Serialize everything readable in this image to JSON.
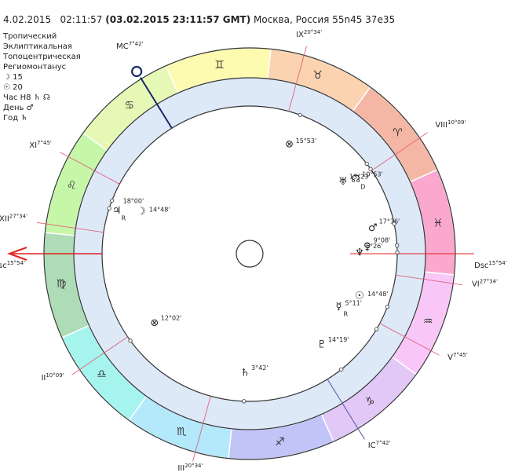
{
  "header": {
    "date": "4.02.2015",
    "time": "02:11:57",
    "gmt": "(03.02.2015  23:11:57 GMT)",
    "place": "Москва, Россия 55n45  37e35"
  },
  "info": {
    "lines": [
      "Тропический",
      "Эклиптикальная",
      "Топоцентрическая",
      "Региомонтанус"
    ],
    "moon": "☽  15",
    "sun": "☉  20",
    "hour": "Час Н8 ♄ ☊",
    "day": "День ♂",
    "year": "Год ♄"
  },
  "colors": {
    "sign_bands": [
      "#f5b7a5",
      "#fbd3b0",
      "#fdfbb0",
      "#e6f8b5",
      "#c6f7a9",
      "#aedcb7",
      "#a5f5ee",
      "#b4e8fb",
      "#c1c4f7",
      "#e1c8f7",
      "#f9c7f7",
      "#fba8cf"
    ],
    "inner_ring": "#dde9f7",
    "house_line": "#e0607c",
    "axis_line": "#e02020",
    "mc_line": "#1a2a6a"
  },
  "signs": [
    {
      "name": "aries",
      "glyph": "♈"
    },
    {
      "name": "taurus",
      "glyph": "♉"
    },
    {
      "name": "gemini",
      "glyph": "♊"
    },
    {
      "name": "cancer",
      "glyph": "♋"
    },
    {
      "name": "leo",
      "glyph": "♌"
    },
    {
      "name": "virgo",
      "glyph": "♍"
    },
    {
      "name": "libra",
      "glyph": "♎"
    },
    {
      "name": "scorpio",
      "glyph": "♏"
    },
    {
      "name": "sagittarius",
      "glyph": "♐"
    },
    {
      "name": "capricorn",
      "glyph": "♑"
    },
    {
      "name": "aquarius",
      "glyph": "♒"
    },
    {
      "name": "pisces",
      "glyph": "♓"
    }
  ],
  "chart_data": {
    "type": "natal-wheel",
    "ascendant": 155.9,
    "houses": [
      {
        "label": "Asc",
        "deg": "15°54'",
        "lon": 155.9
      },
      {
        "label": "II",
        "deg": "10°09'",
        "lon": 190.15
      },
      {
        "label": "III",
        "deg": "20°34'",
        "lon": 230.57
      },
      {
        "label": "IC",
        "deg": "7°42'",
        "lon": 277.7
      },
      {
        "label": "V",
        "deg": "7°45'",
        "lon": 307.75
      },
      {
        "label": "VI",
        "deg": "27°34'",
        "lon": 327.57
      },
      {
        "label": "Dsc",
        "deg": "15°54'",
        "lon": 335.9
      },
      {
        "label": "VIII",
        "deg": "10°09'",
        "lon": 10.15
      },
      {
        "label": "IX",
        "deg": "20°34'",
        "lon": 50.57
      },
      {
        "label": "MC",
        "deg": "7°42'",
        "lon": 97.7
      },
      {
        "label": "XI",
        "deg": "7°45'",
        "lon": 127.75
      },
      {
        "label": "XII",
        "deg": "27°34'",
        "lon": 147.57
      }
    ],
    "planets": [
      {
        "name": "jupiter",
        "glyph": "♃",
        "deg": "18°00'",
        "retro": "R",
        "lon": 138.0
      },
      {
        "name": "moon",
        "glyph": "☽",
        "deg": "14°48'",
        "retro": "",
        "lon": 134.8
      },
      {
        "name": "part-of-fortune",
        "glyph": "⊗",
        "deg": "12°02'",
        "retro": "",
        "lon": 192.0
      },
      {
        "name": "saturn",
        "glyph": "♄",
        "deg": "3°42'",
        "retro": "",
        "lon": 243.7
      },
      {
        "name": "pluto",
        "glyph": "♇",
        "deg": "14°19'",
        "retro": "",
        "lon": 284.3
      },
      {
        "name": "sun",
        "glyph": "☉",
        "deg": "14°48'",
        "retro": "",
        "lon": 314.8
      },
      {
        "name": "mercury",
        "glyph": "☿",
        "deg": "5°11'",
        "retro": "R",
        "lon": 305.2
      },
      {
        "name": "venus",
        "glyph": "♀",
        "deg": "9°08'",
        "retro": "",
        "lon": 339.1
      },
      {
        "name": "mars",
        "glyph": "♂",
        "deg": "17°36'",
        "retro": "",
        "lon": 347.6
      },
      {
        "name": "neptune",
        "glyph": "♆",
        "deg": "6°26'",
        "retro": "",
        "lon": 336.4
      },
      {
        "name": "uranus",
        "glyph": "♅",
        "deg": "13°23'",
        "retro": "",
        "lon": 13.4
      },
      {
        "name": "node",
        "glyph": "☊",
        "deg": "10°53'",
        "retro": "D",
        "lon": 10.9
      },
      {
        "name": "lilith",
        "glyph": "⊗",
        "deg": "15°53'",
        "retro": "",
        "lon": 45.9
      }
    ]
  }
}
